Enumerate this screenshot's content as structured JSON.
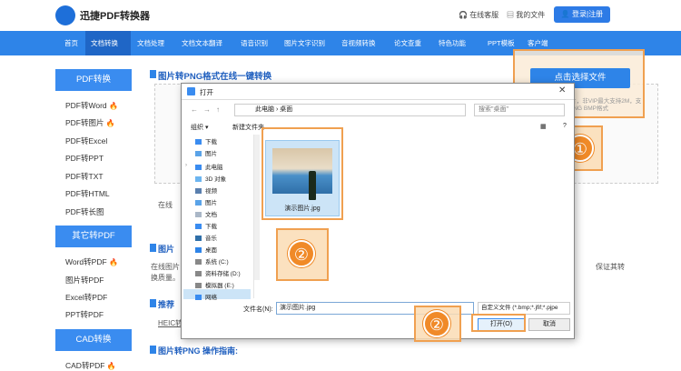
{
  "site": {
    "logo_text": "迅捷PDF转换器",
    "top_links": [
      "在线客服",
      "我的文件"
    ],
    "login_label": "登录|注册"
  },
  "nav": {
    "items": [
      "首页",
      "文档转换",
      "文档处理",
      "文档文本翻译",
      "语音识别",
      "图片文字识别",
      "音视频转换",
      "论文查重",
      "特色功能",
      "PPT模板",
      "客户端"
    ]
  },
  "sidebar": {
    "group1_title": "PDF转换",
    "group1_items": [
      "PDF转Word",
      "PDF转图片",
      "PDF转Excel",
      "PDF转PPT",
      "PDF转TXT",
      "PDF转HTML",
      "PDF转长图"
    ],
    "group2_title": "其它转PDF",
    "group2_items": [
      "Word转PDF",
      "图片转PDF",
      "Excel转PDF",
      "PPT转PDF"
    ],
    "group3_title": "CAD转换",
    "group3_items": [
      "CAD转PDF"
    ],
    "hot_icon": "fire-icon"
  },
  "main": {
    "title": "图片转PNG格式在线一键转换",
    "choose_button": "点击选择文件",
    "upload_note": "请上传需要转换的图片，非VIP最大支持2M，支持JPG PNG BMP格式",
    "section2_title": "图片",
    "body_text_line1": "在线图片",
    "body_text_right": "保证其转",
    "body_text_line2": "换质量。",
    "section3_title": "推荐",
    "heic_text": "HEIC转",
    "section4_title": "图片转PNG 操作指南:",
    "online_text": "在线"
  },
  "dialog": {
    "title": "打开",
    "breadcrumb": [
      "此电脑",
      "桌面"
    ],
    "search_placeholder": "搜索\"桌面\"",
    "organize": "组织 ▾",
    "new_folder": "新建文件夹",
    "tree_items": [
      "下载",
      "图片",
      "此电脑",
      "3D 对象",
      "视频",
      "图片",
      "文档",
      "下载",
      "音乐",
      "桌面",
      "系统 (C:)",
      "资料存储 (D:)",
      "模拟器 (E:)",
      "网络"
    ],
    "file_name": "演示图片.jpg",
    "filename_label": "文件名(N):",
    "filename_value": "演示图片.jpg",
    "filter": "自定义文件 (*.bmp;*.jfif;*.pjpe",
    "open_button": "打开(O)",
    "cancel_button": "取消"
  },
  "badges": [
    "①",
    "②",
    "②"
  ],
  "colors": {
    "primary": "#2e84e8",
    "highlight": "#f08a28"
  }
}
